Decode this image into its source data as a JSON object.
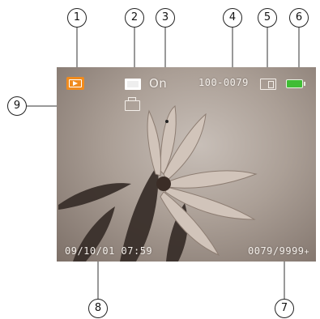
{
  "callouts": [
    "1",
    "2",
    "3",
    "4",
    "5",
    "6",
    "7",
    "8",
    "9"
  ],
  "screen": {
    "protect_status": "On",
    "file_number": "100-0079",
    "date_time": "09/10/01 07:59",
    "image_counter": "0079/9999",
    "counter_marker": "+"
  },
  "icons": {
    "playback": "playback-mode-icon",
    "memory": "internal-memory-icon",
    "protect": "protect-on-indicator",
    "sd_card": "sd-card-icon",
    "battery": "battery-full-icon",
    "print": "dpof-print-icon"
  },
  "colors": {
    "playback_icon": "#f08b1e",
    "battery_fill": "#3fbd35",
    "osd_text": "#f4efea"
  }
}
